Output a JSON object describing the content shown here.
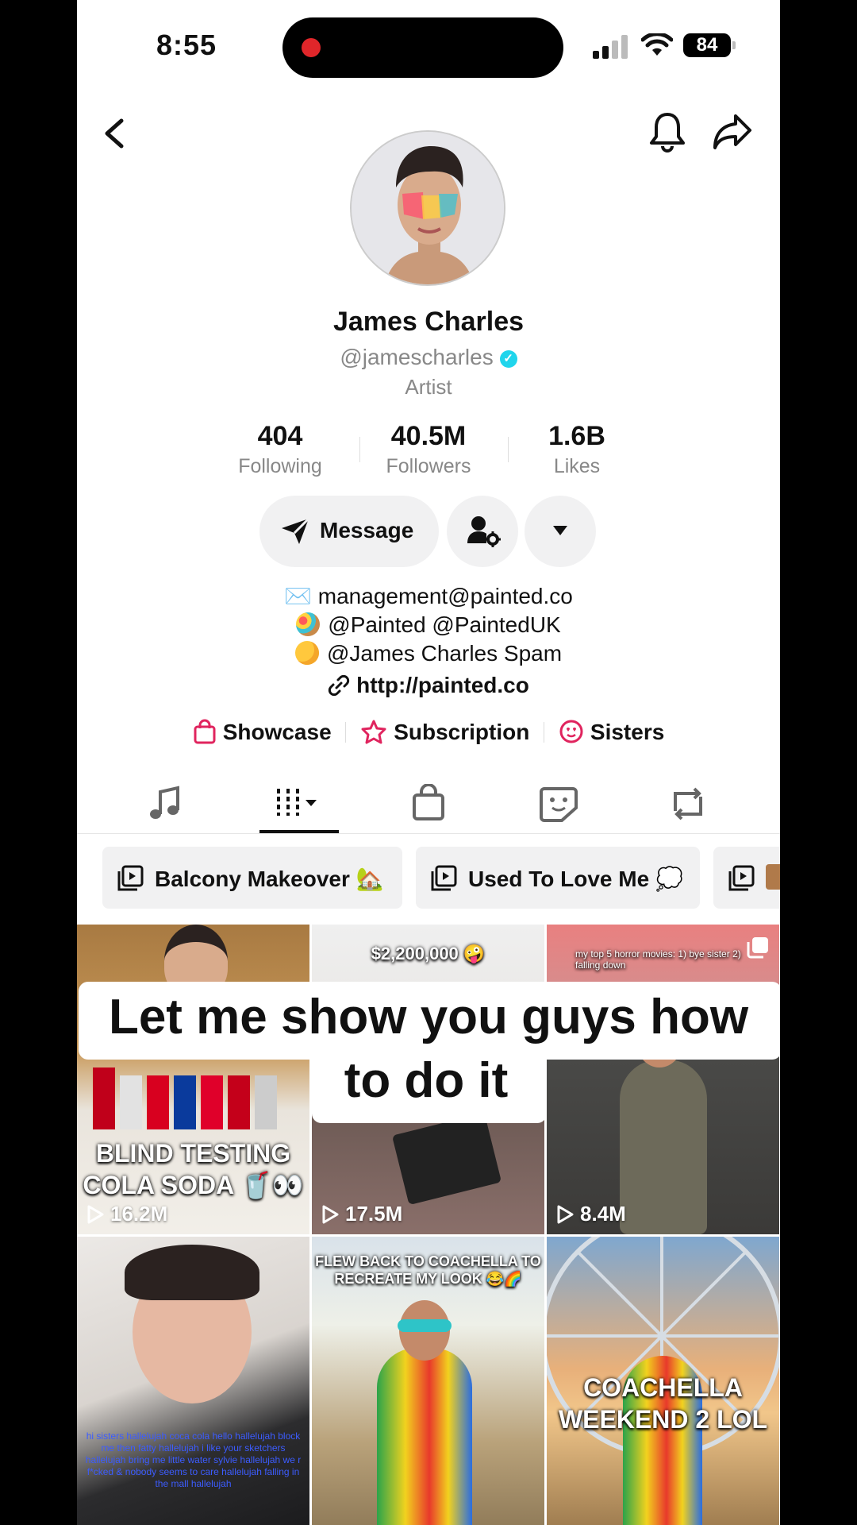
{
  "status_bar": {
    "time": "8:55",
    "battery": "84"
  },
  "profile": {
    "name": "James Charles",
    "handle": "@jamescharles",
    "category": "Artist",
    "stats": [
      {
        "value": "404",
        "label": "Following"
      },
      {
        "value": "40.5M",
        "label": "Followers"
      },
      {
        "value": "1.6B",
        "label": "Likes"
      }
    ]
  },
  "actions": {
    "message_label": "Message"
  },
  "bio": {
    "email": "management@painted.co",
    "line2": "@Painted @PaintedUK",
    "line3": "@James Charles Spam",
    "link": "http://painted.co"
  },
  "features": [
    {
      "label": "Showcase",
      "icon": "shopping-bag-icon"
    },
    {
      "label": "Subscription",
      "icon": "star-icon"
    },
    {
      "label": "Sisters",
      "icon": "heart-face-icon"
    }
  ],
  "tabs": [
    {
      "icon": "music-note-icon"
    },
    {
      "icon": "grid-sort-icon",
      "active": true
    },
    {
      "icon": "shopping-bag-icon"
    },
    {
      "icon": "sticker-icon"
    },
    {
      "icon": "repost-icon"
    }
  ],
  "playlists": [
    "Balcony Makeover 🏡",
    "Used To Love Me 💭"
  ],
  "videos": [
    {
      "views": "16.2M",
      "overlay": "BLIND TESTING COLA SODA 🥤👀"
    },
    {
      "views": "17.5M",
      "overlay": "$2,200,000 🤪"
    },
    {
      "views": "8.4M",
      "overlay": "my top 5 horror movies: 1) bye sister 2) falling down"
    },
    {
      "views": "",
      "overlay": "hi sisters hallelujah coca cola hello hallelujah block me then fatty hallelujah i like your sketchers hallelujah bring me little water sylvie hallelujah we r f*cked & nobody seems to care hallelujah falling in the mall hallelujah"
    },
    {
      "views": "",
      "overlay": "FLEW BACK TO COACHELLA TO RECREATE MY LOOK 😂🌈"
    },
    {
      "views": "",
      "overlay": "COACHELLA WEEKEND 2 LOL"
    }
  ],
  "caption": {
    "line1": "Let me show you guys how",
    "line2": "to do it"
  },
  "colors": {
    "accent": "#fe2c55",
    "verified": "#20d5ec"
  }
}
